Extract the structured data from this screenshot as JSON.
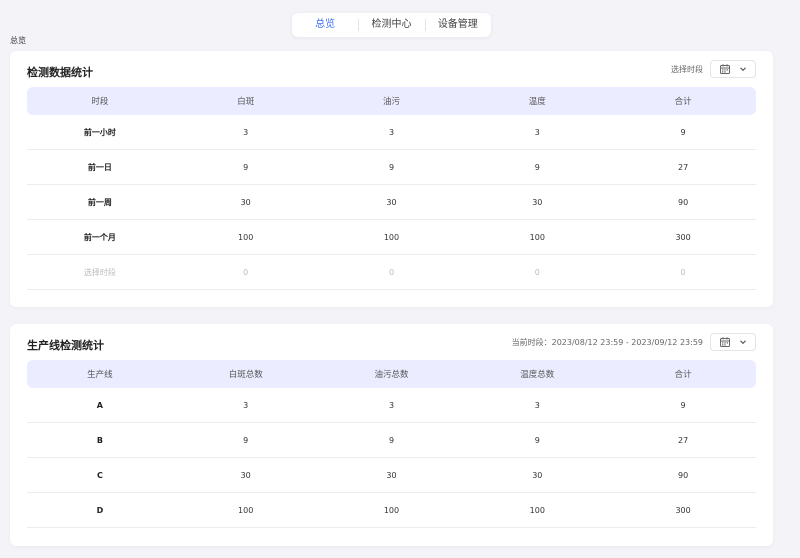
{
  "nav": {
    "tabs": [
      {
        "label": "总览",
        "active": true
      },
      {
        "label": "检测中心",
        "active": false
      },
      {
        "label": "设备管理",
        "active": false
      }
    ]
  },
  "breadcrumb": "总览",
  "colors": {
    "accent": "#3b6ef5",
    "header_bg": "#ebecff",
    "page_bg": "#f3f3f8"
  },
  "detection_stats": {
    "title": "检测数据统计",
    "period_label": "选择时段",
    "calendar_icon": "calendar-icon",
    "columns": [
      "时段",
      "白斑",
      "油污",
      "温度",
      "合计"
    ],
    "rows": [
      [
        "前一小时",
        "3",
        "3",
        "3",
        "9"
      ],
      [
        "前一日",
        "9",
        "9",
        "9",
        "27"
      ],
      [
        "前一周",
        "30",
        "30",
        "30",
        "90"
      ],
      [
        "前一个月",
        "100",
        "100",
        "100",
        "300"
      ],
      [
        "选择时段",
        "0",
        "0",
        "0",
        "0"
      ]
    ]
  },
  "line_stats": {
    "title": "生产线检测统计",
    "period_label": "当前时段：2023/08/12 23:59 - 2023/09/12 23:59",
    "calendar_icon": "calendar-icon",
    "columns": [
      "生产线",
      "白斑总数",
      "油污总数",
      "温度总数",
      "合计"
    ],
    "rows": [
      [
        "A",
        "3",
        "3",
        "3",
        "9"
      ],
      [
        "B",
        "9",
        "9",
        "9",
        "27"
      ],
      [
        "C",
        "30",
        "30",
        "30",
        "90"
      ],
      [
        "D",
        "100",
        "100",
        "100",
        "300"
      ]
    ]
  }
}
